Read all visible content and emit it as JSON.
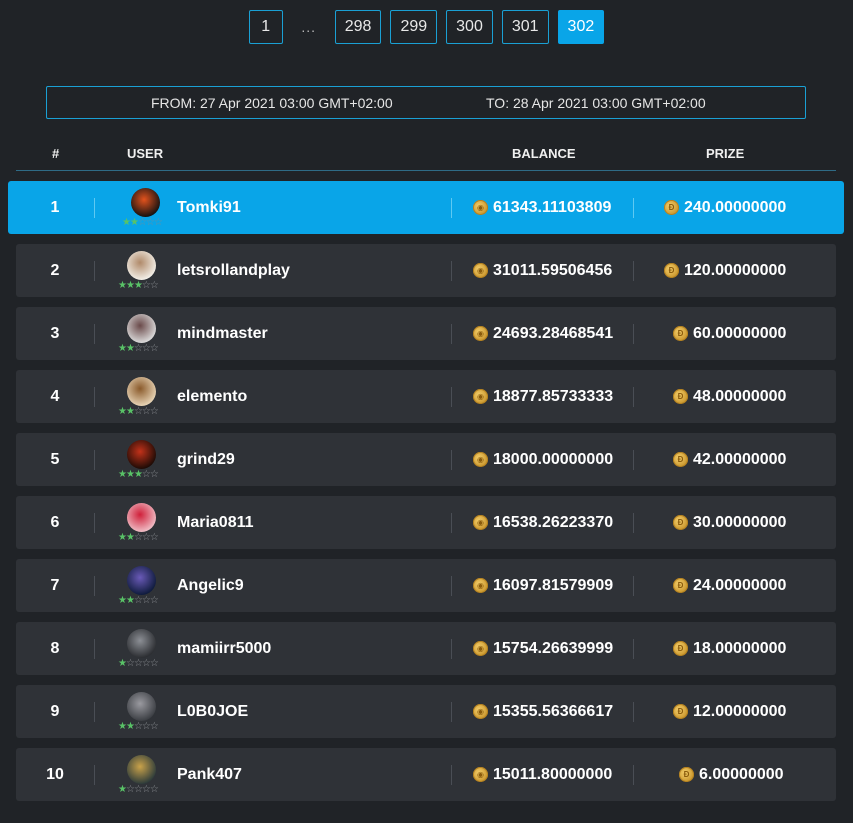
{
  "pagination": {
    "pages": [
      "1",
      "298",
      "299",
      "300",
      "301",
      "302"
    ],
    "ellipsis": "...",
    "active": "302"
  },
  "range": {
    "from": "FROM: 27 Apr 2021 03:00 GMT+02:00",
    "to": "TO: 28 Apr 2021 03:00 GMT+02:00"
  },
  "table": {
    "headers": {
      "rank": "#",
      "user": "USER",
      "balance": "BALANCE",
      "prize": "PRIZE"
    },
    "rows": [
      {
        "rank": "1",
        "user": "Tomki91",
        "stars": 2,
        "balance": "61343.11103809",
        "prize": "240.00000000"
      },
      {
        "rank": "2",
        "user": "letsrollandplay",
        "stars": 3,
        "balance": "31011.59506456",
        "prize": "120.00000000"
      },
      {
        "rank": "3",
        "user": "mindmaster",
        "stars": 2,
        "balance": "24693.28468541",
        "prize": "60.00000000"
      },
      {
        "rank": "4",
        "user": "elemento",
        "stars": 2,
        "balance": "18877.85733333",
        "prize": "48.00000000"
      },
      {
        "rank": "5",
        "user": "grind29",
        "stars": 3,
        "balance": "18000.00000000",
        "prize": "42.00000000"
      },
      {
        "rank": "6",
        "user": "Maria0811",
        "stars": 2,
        "balance": "16538.26223370",
        "prize": "30.00000000"
      },
      {
        "rank": "7",
        "user": "Angelic9",
        "stars": 2,
        "balance": "16097.81579909",
        "prize": "24.00000000"
      },
      {
        "rank": "8",
        "user": "mamiirr5000",
        "stars": 1,
        "balance": "15754.26639999",
        "prize": "18.00000000"
      },
      {
        "rank": "9",
        "user": "L0B0JOE",
        "stars": 2,
        "balance": "15355.56366617",
        "prize": "12.00000000"
      },
      {
        "rank": "10",
        "user": "Pank407",
        "stars": 1,
        "balance": "15011.80000000",
        "prize": "6.00000000"
      }
    ]
  },
  "icons": {
    "balance_icon": "gold-coin-icon",
    "prize_icon": "dogecoin-icon",
    "star_on": "★",
    "star_off": "☆"
  },
  "colors": {
    "accent": "#09a5e8",
    "row_bg": "#2f3237",
    "page_bg": "#202327",
    "star_green": "#59c267"
  }
}
